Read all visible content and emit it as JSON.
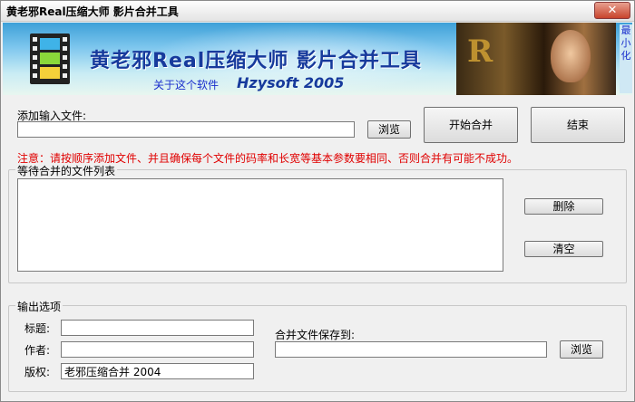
{
  "window": {
    "title": "黄老邪Real压缩大师 影片合并工具",
    "close_glyph": "✕"
  },
  "banner": {
    "title": "黄老邪Real压缩大师  影片合并工具",
    "about_link": "关于这个软件",
    "brand": "Hzysoft 2005",
    "minimize_label": "最小化",
    "movie_logo": "R"
  },
  "input_section": {
    "label": "添加输入文件:",
    "input_value": "",
    "browse_label": "浏览",
    "start_merge_label": "开始合并",
    "end_label": "结束"
  },
  "warning": "注意：请按顺序添加文件、并且确保每个文件的码率和长宽等基本参数要相同、否则合并有可能不成功。",
  "file_list": {
    "group_title": "等待合并的文件列表",
    "items": [],
    "delete_label": "删除",
    "clear_label": "清空"
  },
  "output": {
    "group_title": "输出选项",
    "title_label": "标题:",
    "title_value": "",
    "author_label": "作者:",
    "author_value": "",
    "copyright_label": "版权:",
    "copyright_value": "老邪压缩合并 2004",
    "save_to_label": "合并文件保存到:",
    "save_to_value": "",
    "browse_label": "浏览"
  },
  "colors": {
    "warning": "#e00000",
    "banner_title": "#173a9c",
    "link": "#1a2ecc"
  }
}
